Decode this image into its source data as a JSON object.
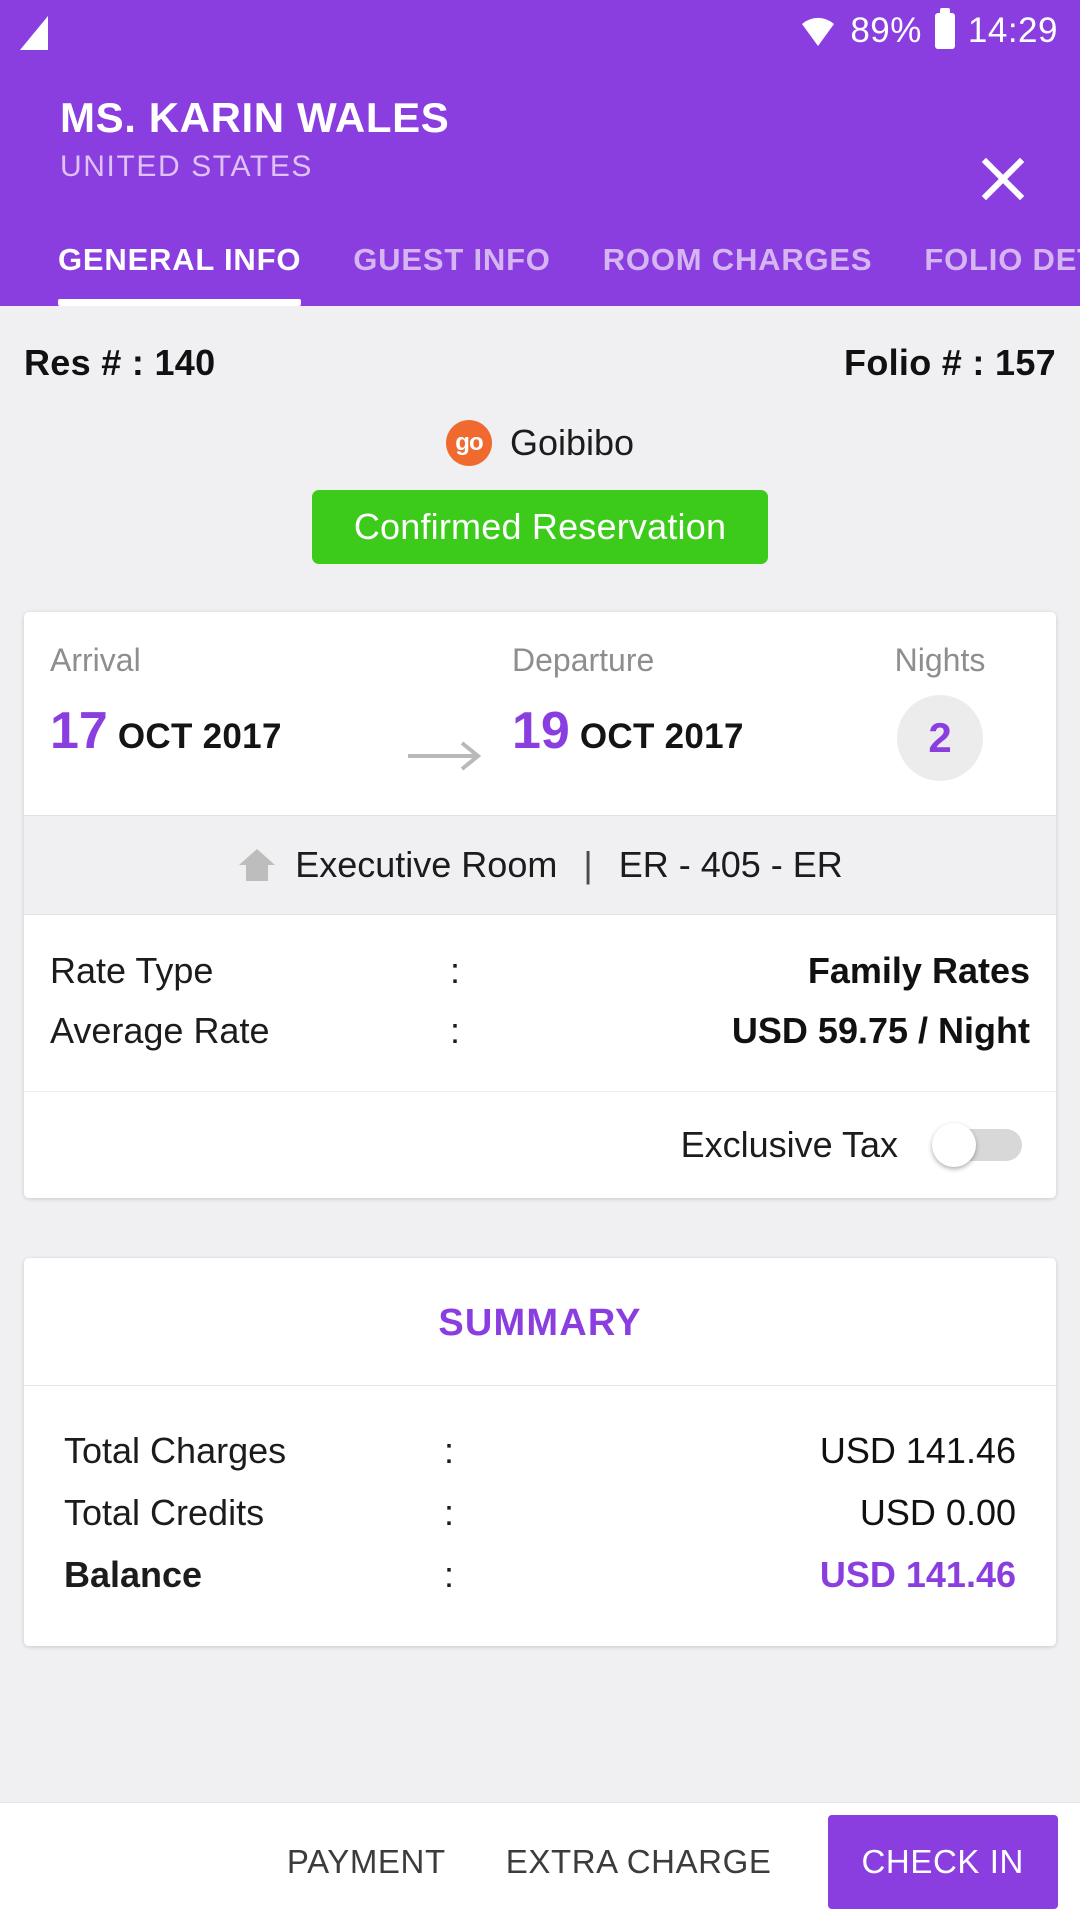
{
  "status_bar": {
    "signal_icon": "signal-triangle-icon",
    "wifi_icon": "wifi-icon",
    "battery_percent": "89%",
    "battery_icon": "battery-icon",
    "time": "14:29"
  },
  "app_bar": {
    "guest_name": "MS. KARIN WALES",
    "guest_country": "UNITED STATES",
    "close_icon": "close-icon"
  },
  "tabs": [
    {
      "label": "GENERAL INFO",
      "active": true
    },
    {
      "label": "GUEST INFO",
      "active": false
    },
    {
      "label": "ROOM CHARGES",
      "active": false
    },
    {
      "label": "FOLIO DETAILS",
      "active": false
    }
  ],
  "reservation": {
    "res_number": "Res # : 140",
    "folio_number": "Folio # : 157",
    "source_logo_text": "go",
    "source_name": "Goibibo",
    "status_label": "Confirmed Reservation",
    "status_color": "#3ccb1a"
  },
  "stay": {
    "arrival_label": "Arrival",
    "arrival_day": "17",
    "arrival_monthyear": "OCT 2017",
    "arrow_icon": "arrow-right-icon",
    "departure_label": "Departure",
    "departure_day": "19",
    "departure_monthyear": "OCT 2017",
    "nights_label": "Nights",
    "nights_count": "2"
  },
  "room": {
    "home_icon": "home-icon",
    "room_type": "Executive Room",
    "separator": "|",
    "room_code": "ER - 405 - ER"
  },
  "rates": {
    "rows": [
      {
        "key": "Rate Type",
        "colon": ":",
        "value": "Family Rates"
      },
      {
        "key": "Average Rate",
        "colon": ":",
        "value": "USD 59.75 / Night"
      }
    ],
    "exclusive_tax_label": "Exclusive Tax",
    "exclusive_tax_on": false
  },
  "summary": {
    "title": "SUMMARY",
    "rows": [
      {
        "key": "Total Charges",
        "colon": ":",
        "value": "USD 141.46"
      },
      {
        "key": "Total Credits",
        "colon": ":",
        "value": "USD 0.00"
      },
      {
        "key": "Balance",
        "colon": ":",
        "value": "USD 141.46"
      }
    ]
  },
  "bottom_bar": {
    "payment_label": "PAYMENT",
    "extra_charge_label": "EXTRA CHARGE",
    "check_in_label": "CHECK IN"
  },
  "colors": {
    "brand_purple": "#8b3ee0",
    "status_green": "#3ccb1a",
    "source_orange": "#f0692e"
  }
}
